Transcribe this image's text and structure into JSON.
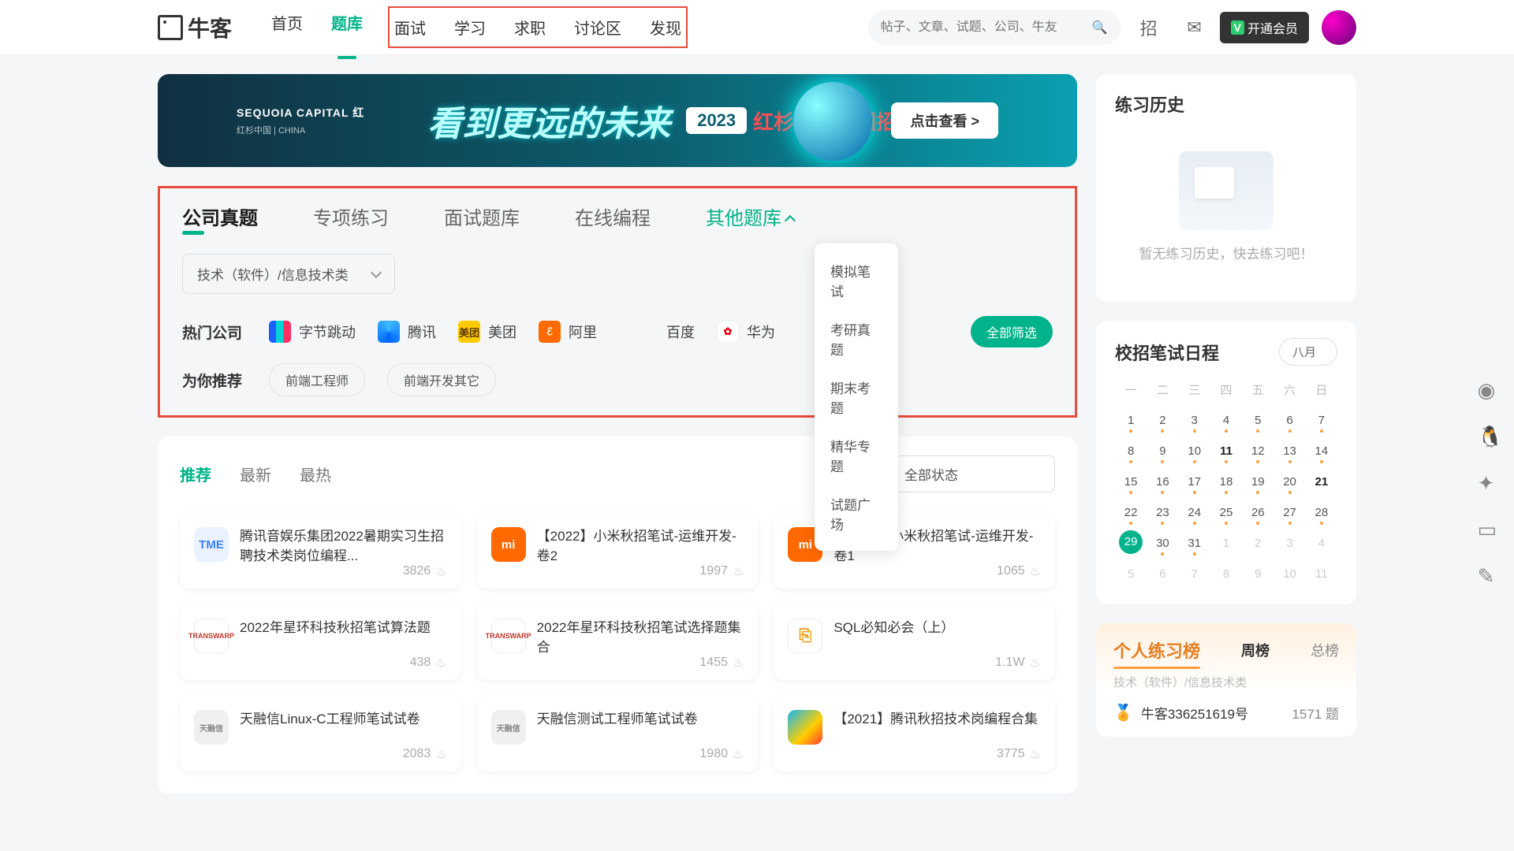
{
  "header": {
    "logo": "牛客",
    "nav": [
      "首页",
      "题库",
      "面试",
      "学习",
      "求职",
      "讨论区",
      "发现"
    ],
    "active_nav": "题库",
    "search_placeholder": "帖子、文章、试题、公司、牛友",
    "vip_label": "开通会员"
  },
  "banner": {
    "brand": "SEQUOIA CAPITAL 红",
    "brand_sub": "红杉中国 | CHINA",
    "headline": "看到更远的未来",
    "year": "2023",
    "slogan": "红杉联合校园招聘",
    "cta": "点击查看 >"
  },
  "tabs": [
    "公司真题",
    "专项练习",
    "面试题库",
    "在线编程",
    "其他题库"
  ],
  "tabs_active": "公司真题",
  "tabs_open": "其他题库",
  "dropdown": [
    "模拟笔试",
    "考研真题",
    "期末考题",
    "精华专题",
    "试题广场"
  ],
  "category_select": "技术（软件）/信息技术类",
  "row_companies_label": "热门公司",
  "companies": [
    "字节跳动",
    "腾讯",
    "美团",
    "阿里",
    "百度",
    "华为"
  ],
  "filter_all": "全部筛选",
  "row_reco_label": "为你推荐",
  "reco_chips": [
    "前端工程师",
    "前端开发其它"
  ],
  "list_tabs": [
    "推荐",
    "最新",
    "最热"
  ],
  "list_tab_active": "推荐",
  "state_select": "全部状态",
  "questions": [
    {
      "logo": "tme",
      "logotext": "TME",
      "title": "腾讯音娱乐集团2022暑期实习生招聘技术类岗位编程...",
      "meta": "3826"
    },
    {
      "logo": "mi",
      "logotext": "mi",
      "title": "【2022】小米秋招笔试-运维开发-卷2",
      "meta": "1997"
    },
    {
      "logo": "mi",
      "logotext": "mi",
      "title": "【2022】小米秋招笔试-运维开发-卷1",
      "meta": "1065"
    },
    {
      "logo": "transwarp",
      "logotext": "TRANSWARP",
      "title": "2022年星环科技秋招笔试算法题",
      "meta": "438"
    },
    {
      "logo": "transwarp",
      "logotext": "TRANSWARP",
      "title": "2022年星环科技秋招笔试选择题集合",
      "meta": "1455"
    },
    {
      "logo": "sql",
      "logotext": "⎘",
      "title": "SQL必知必会（上）",
      "meta": "1.1W"
    },
    {
      "logo": "trx",
      "logotext": "天融信",
      "title": "天融信Linux-C工程师笔试试卷",
      "meta": "2083"
    },
    {
      "logo": "trx",
      "logotext": "天融信",
      "title": "天融信测试工程师笔试试卷",
      "meta": "1980"
    },
    {
      "logo": "tq",
      "logotext": "",
      "title": "【2021】腾讯秋招技术岗编程合集",
      "meta": "3775"
    }
  ],
  "history": {
    "title": "练习历史",
    "empty": "暂无练习历史，快去练习吧！"
  },
  "calendar": {
    "title": "校招笔试日程",
    "month": "八月",
    "weekdays": [
      "一",
      "二",
      "三",
      "四",
      "五",
      "六",
      "日"
    ],
    "days": [
      {
        "n": "1",
        "dot": true
      },
      {
        "n": "2",
        "dot": true
      },
      {
        "n": "3",
        "dot": true
      },
      {
        "n": "4",
        "dot": true
      },
      {
        "n": "5",
        "dot": true
      },
      {
        "n": "6",
        "dot": true
      },
      {
        "n": "7",
        "dot": true
      },
      {
        "n": "8",
        "dot": true
      },
      {
        "n": "9",
        "dot": true
      },
      {
        "n": "10",
        "dot": true
      },
      {
        "n": "11",
        "bold": true,
        "dot": true
      },
      {
        "n": "12",
        "dot": true
      },
      {
        "n": "13",
        "dot": true
      },
      {
        "n": "14",
        "dot": true
      },
      {
        "n": "15",
        "dot": true
      },
      {
        "n": "16",
        "dot": true
      },
      {
        "n": "17",
        "dot": true
      },
      {
        "n": "18",
        "dot": true
      },
      {
        "n": "19",
        "dot": true
      },
      {
        "n": "20",
        "dot": true
      },
      {
        "n": "21",
        "bold": true
      },
      {
        "n": "22",
        "dot": true
      },
      {
        "n": "23",
        "dot": true
      },
      {
        "n": "24",
        "dot": true
      },
      {
        "n": "25",
        "dot": true
      },
      {
        "n": "26",
        "dot": true
      },
      {
        "n": "27",
        "dot": true
      },
      {
        "n": "28",
        "dot": true
      },
      {
        "n": "29",
        "today": true
      },
      {
        "n": "30",
        "dot": true
      },
      {
        "n": "31",
        "dot": true
      },
      {
        "n": "1",
        "mute": true
      },
      {
        "n": "2",
        "mute": true
      },
      {
        "n": "3",
        "mute": true
      },
      {
        "n": "4",
        "mute": true
      },
      {
        "n": "5",
        "mute": true
      },
      {
        "n": "6",
        "mute": true
      },
      {
        "n": "7",
        "mute": true
      },
      {
        "n": "8",
        "mute": true
      },
      {
        "n": "9",
        "mute": true
      },
      {
        "n": "10",
        "mute": true
      },
      {
        "n": "11",
        "mute": true
      }
    ]
  },
  "rank": {
    "title": "个人练习榜",
    "tabs": [
      "周榜",
      "总榜"
    ],
    "tab_active": "周榜",
    "sub": "技术（软件）/信息技术类",
    "first_user": "牛客336251619号",
    "first_count": "1571",
    "count_unit": "题"
  }
}
